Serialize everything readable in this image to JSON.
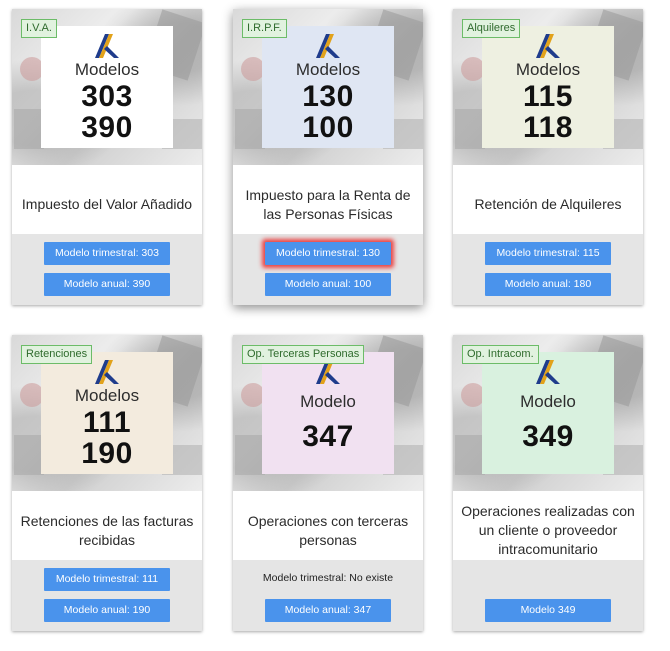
{
  "cards": [
    {
      "tag": "I.V.A.",
      "poster_title": "Modelos",
      "numbers": [
        "303",
        "390"
      ],
      "poster_color": "#ffffff",
      "description": "Impuesto del Valor Añadido",
      "buttons": [
        "Modelo trimestral: 303",
        "Modelo anual: 390"
      ]
    },
    {
      "tag": "I.R.P.F.",
      "poster_title": "Modelos",
      "numbers": [
        "130",
        "100"
      ],
      "poster_color": "#dfe6f3",
      "description": "Impuesto para la Renta de las Personas Físicas",
      "buttons": [
        "Modelo trimestral: 130",
        "Modelo anual: 100"
      ],
      "highlighted_button": "Modelo trimestral: 130"
    },
    {
      "tag": "Alquileres",
      "poster_title": "Modelos",
      "numbers": [
        "115",
        "118"
      ],
      "poster_color": "#eef0e1",
      "description": "Retención de Alquileres",
      "buttons": [
        "Modelo trimestral: 115",
        "Modelo anual: 180"
      ]
    },
    {
      "tag": "Retenciones",
      "poster_title": "Modelos",
      "numbers": [
        "111",
        "190"
      ],
      "poster_color": "#f3ebde",
      "description": "Retenciones de las facturas recibidas",
      "buttons": [
        "Modelo trimestral: 111",
        "Modelo anual: 190"
      ]
    },
    {
      "tag": "Op. Terceras Personas",
      "poster_title": "Modelo",
      "numbers": [
        "347"
      ],
      "poster_color": "#f1e1f1",
      "description": "Operaciones con terceras personas",
      "note": "Modelo trimestral: No existe",
      "buttons": [
        "Modelo anual: 347"
      ]
    },
    {
      "tag": "Op. Intracom.",
      "poster_title": "Modelo",
      "numbers": [
        "349"
      ],
      "poster_color": "#d9f1df",
      "description": "Operaciones realizadas con un cliente o proveedor intracomunitario",
      "buttons": [
        "Modelo 349"
      ]
    }
  ],
  "colors": {
    "button": "#4a93ec",
    "tag_background": "#e1f2df",
    "tag_border": "#6cbc68",
    "button_area": "#e5e5e5",
    "highlight_glow": "#eb2828"
  },
  "icons": {
    "logo": "agencia-tributaria-logo"
  }
}
